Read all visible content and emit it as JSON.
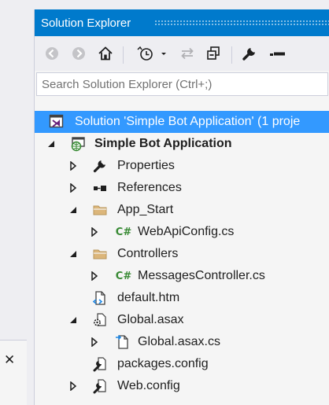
{
  "panel": {
    "title": "Solution Explorer",
    "close_glyph": "✕"
  },
  "toolbar": {
    "buttons": [
      {
        "name": "back-button",
        "icon": "arrow-left-circle-icon"
      },
      {
        "name": "forward-button",
        "icon": "arrow-right-circle-icon"
      },
      {
        "name": "home-button",
        "icon": "home-icon"
      },
      {
        "name": "pending-changes-filter-button",
        "icon": "clock-icon"
      },
      {
        "name": "sync-with-active-document-button",
        "icon": "sync-arrows-icon"
      },
      {
        "name": "collapse-all-button",
        "icon": "collapse-all-icon"
      },
      {
        "name": "properties-button",
        "icon": "wrench-icon"
      },
      {
        "name": "preview-selected-items-button",
        "icon": "dash-icon"
      }
    ]
  },
  "search": {
    "placeholder": "Search Solution Explorer (Ctrl+;)",
    "value": ""
  },
  "tree": {
    "items": [
      {
        "label": "Solution 'Simple Bot Application' (1 proje",
        "icon": "visual-studio-solution-icon",
        "expander": "none",
        "selected": true,
        "bold": false
      },
      {
        "label": "Simple Bot Application",
        "icon": "web-project-icon",
        "expander": "expanded",
        "selected": false,
        "bold": true
      },
      {
        "label": "Properties",
        "icon": "wrench-icon",
        "expander": "collapsed",
        "selected": false,
        "bold": false
      },
      {
        "label": "References",
        "icon": "references-icon",
        "expander": "collapsed",
        "selected": false,
        "bold": false
      },
      {
        "label": "App_Start",
        "icon": "folder-icon",
        "expander": "expanded",
        "selected": false,
        "bold": false
      },
      {
        "label": "WebApiConfig.cs",
        "icon": "csharp-file-icon",
        "expander": "collapsed",
        "selected": false,
        "bold": false
      },
      {
        "label": "Controllers",
        "icon": "folder-icon",
        "expander": "expanded",
        "selected": false,
        "bold": false
      },
      {
        "label": "MessagesController.cs",
        "icon": "csharp-file-icon",
        "expander": "collapsed",
        "selected": false,
        "bold": false
      },
      {
        "label": "default.htm",
        "icon": "html-file-icon",
        "expander": "none",
        "selected": false,
        "bold": false
      },
      {
        "label": "Global.asax",
        "icon": "asax-file-icon",
        "expander": "expanded",
        "selected": false,
        "bold": false
      },
      {
        "label": "Global.asax.cs",
        "icon": "code-behind-file-icon",
        "expander": "collapsed",
        "selected": false,
        "bold": false
      },
      {
        "label": "packages.config",
        "icon": "config-file-icon",
        "expander": "none",
        "selected": false,
        "bold": false
      },
      {
        "label": "Web.config",
        "icon": "config-file-icon",
        "expander": "collapsed",
        "selected": false,
        "bold": false
      }
    ]
  },
  "colors": {
    "accent": "#007acc",
    "selection": "#3399ff",
    "csharp_green": "#388a34",
    "folder": "#dcb67a"
  }
}
